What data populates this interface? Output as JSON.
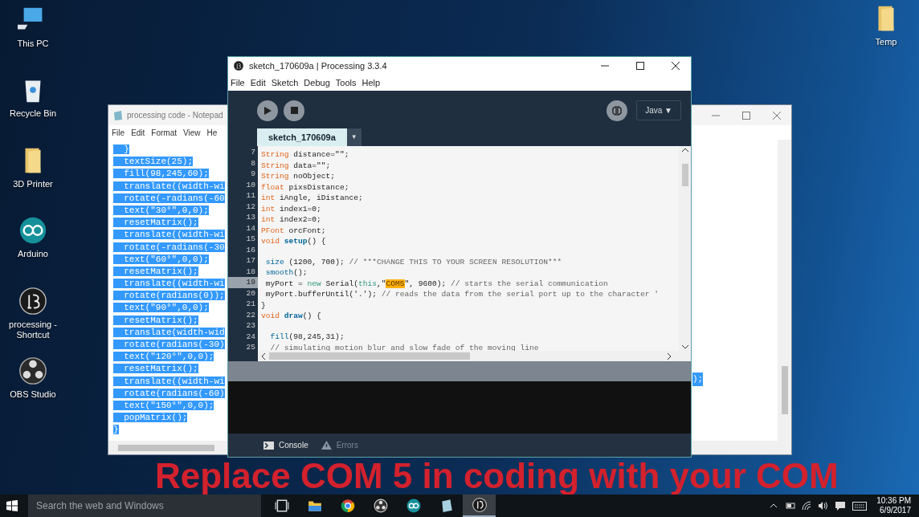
{
  "desktop_icons": [
    {
      "label": "This PC",
      "kind": "pc"
    },
    {
      "label": "Recycle Bin",
      "kind": "bin"
    },
    {
      "label": "3D Printer",
      "kind": "folder"
    },
    {
      "label": "Arduino",
      "kind": "arduino"
    },
    {
      "label": "processing - Shortcut",
      "kind": "processing"
    },
    {
      "label": "OBS Studio",
      "kind": "obs"
    },
    {
      "label": "Temp",
      "kind": "folder"
    }
  ],
  "notepad": {
    "title": "processing code - Notepad",
    "menu": [
      "File",
      "Edit",
      "Format",
      "View",
      "He"
    ],
    "lines": [
      {
        "text": "  }",
        "selected": true
      },
      {
        "text": "  textSize(25);",
        "selected": true
      },
      {
        "text": "  fill(98,245,60);",
        "selected": true
      },
      {
        "text": "  translate((width-wi",
        "selected": true
      },
      {
        "text": "  rotate(-radians(-60",
        "selected": true
      },
      {
        "text": "  text(\"30°\",0,0);",
        "selected": true
      },
      {
        "text": "  resetMatrix();",
        "selected": true
      },
      {
        "text": "  translate((width-wi",
        "selected": true
      },
      {
        "text": "  rotate(-radians(-30",
        "selected": true
      },
      {
        "text": "  text(\"60°\",0,0);",
        "selected": true
      },
      {
        "text": "  resetMatrix();",
        "selected": true
      },
      {
        "text": "  translate((width-wi",
        "selected": true
      },
      {
        "text": "  rotate(radians(0));",
        "selected": true
      },
      {
        "text": "  text(\"90°\",0,0);",
        "selected": true
      },
      {
        "text": "  resetMatrix();",
        "selected": true
      },
      {
        "text": "  translate(width-wid",
        "selected": true
      },
      {
        "text": "  rotate(radians(-30)",
        "selected": true
      },
      {
        "text": "  text(\"120°\",0,0);",
        "selected": true
      },
      {
        "text": "  resetMatrix();",
        "selected": true
      },
      {
        "text": "  translate((width-wi",
        "selected": true
      },
      {
        "text": "  rotate(radians(-60)",
        "selected": true
      },
      {
        "text": "  text(\"150°\",0,0);",
        "selected": true
      },
      {
        "text": "  popMatrix();",
        "selected": true
      },
      {
        "text": "}",
        "selected": true
      }
    ],
    "right_fragment": {
      "text": ");",
      "selected": true
    }
  },
  "processing": {
    "title": "sketch_170609a | Processing 3.3.4",
    "menu": [
      "File",
      "Edit",
      "Sketch",
      "Debug",
      "Tools",
      "Help"
    ],
    "mode": "Java ▼",
    "tabs": [
      {
        "label": "sketch_170609a",
        "selected": true
      }
    ],
    "tab_menu": "▼",
    "code": [
      {
        "number": "7",
        "current": false,
        "tokens": [
          {
            "kind": "type",
            "text": "String"
          },
          {
            "kind": "plain",
            "text": " distance=\"\";"
          }
        ]
      },
      {
        "number": "8",
        "current": false,
        "tokens": [
          {
            "kind": "type",
            "text": "String"
          },
          {
            "kind": "plain",
            "text": " data=\"\";"
          }
        ]
      },
      {
        "number": "9",
        "current": false,
        "tokens": [
          {
            "kind": "type",
            "text": "String"
          },
          {
            "kind": "plain",
            "text": " noObject;"
          }
        ]
      },
      {
        "number": "10",
        "current": false,
        "tokens": [
          {
            "kind": "type",
            "text": "float"
          },
          {
            "kind": "plain",
            "text": " pixsDistance;"
          }
        ]
      },
      {
        "number": "11",
        "current": false,
        "tokens": [
          {
            "kind": "type",
            "text": "int"
          },
          {
            "kind": "plain",
            "text": " iAngle, iDistance;"
          }
        ]
      },
      {
        "number": "12",
        "current": false,
        "tokens": [
          {
            "kind": "type",
            "text": "int"
          },
          {
            "kind": "plain",
            "text": " index1=0;"
          }
        ]
      },
      {
        "number": "13",
        "current": false,
        "tokens": [
          {
            "kind": "type",
            "text": "int"
          },
          {
            "kind": "plain",
            "text": " index2=0;"
          }
        ]
      },
      {
        "number": "14",
        "current": false,
        "tokens": [
          {
            "kind": "type",
            "text": "PFont"
          },
          {
            "kind": "plain",
            "text": " orcFont;"
          }
        ]
      },
      {
        "number": "15",
        "current": false,
        "tokens": [
          {
            "kind": "type",
            "text": "void"
          },
          {
            "kind": "function",
            "text": " setup"
          },
          {
            "kind": "plain",
            "text": "() {"
          }
        ]
      },
      {
        "number": "16",
        "current": false
      },
      {
        "number": "17",
        "current": false,
        "tokens": [
          {
            "kind": "builtin",
            "text": " size"
          },
          {
            "kind": "plain",
            "text": " (1200, 700); "
          },
          {
            "kind": "comment",
            "text": "// ***CHANGE THIS TO YOUR SCREEN RESOLUTION***"
          }
        ]
      },
      {
        "number": "18",
        "current": false,
        "tokens": [
          {
            "kind": "builtin",
            "text": " smooth"
          },
          {
            "kind": "plain",
            "text": "();"
          }
        ]
      },
      {
        "number": "19",
        "current": true,
        "tokens": [
          {
            "kind": "plain",
            "text": " myPort = "
          },
          {
            "kind": "keyword",
            "text": "new"
          },
          {
            "kind": "plain",
            "text": " Serial("
          },
          {
            "kind": "keyword",
            "text": "this"
          },
          {
            "kind": "plain",
            "text": ",\""
          },
          {
            "kind": "selection",
            "text": "COM5"
          },
          {
            "kind": "plain",
            "text": "\", 9600); "
          },
          {
            "kind": "comment",
            "text": "// starts the serial communication"
          }
        ]
      },
      {
        "number": "20",
        "current": false,
        "tokens": [
          {
            "kind": "plain",
            "text": " myPort.bufferUntil('.'); "
          },
          {
            "kind": "comment",
            "text": "// reads the data from the serial port up to the character '"
          }
        ]
      },
      {
        "number": "21",
        "current": false,
        "tokens": [
          {
            "kind": "plain",
            "text": "}"
          }
        ]
      },
      {
        "number": "22",
        "current": false,
        "tokens": [
          {
            "kind": "type",
            "text": "void"
          },
          {
            "kind": "function",
            "text": " draw"
          },
          {
            "kind": "plain",
            "text": "() {"
          }
        ]
      },
      {
        "number": "23",
        "current": false
      },
      {
        "number": "24",
        "current": false,
        "tokens": [
          {
            "kind": "builtin",
            "text": "  fill"
          },
          {
            "kind": "plain",
            "text": "(98,245,31);"
          }
        ]
      },
      {
        "number": "25",
        "current": false,
        "tokens": [
          {
            "kind": "comment",
            "text": "  // simulating motion blur and slow fade of the moving line"
          }
        ]
      }
    ],
    "console_tabs": [
      {
        "label": "Console",
        "kind": "console",
        "selected": true
      },
      {
        "label": "Errors",
        "kind": "errors",
        "selected": false
      }
    ]
  },
  "caption": "Replace COM 5 in coding with your COM",
  "taskbar": {
    "search_placeholder": "Search the web and Windows",
    "apps": [
      {
        "kind": "taskview",
        "selected": false
      },
      {
        "kind": "explorer",
        "selected": false
      },
      {
        "kind": "chrome",
        "selected": false
      },
      {
        "kind": "obs",
        "selected": false
      },
      {
        "kind": "arduino",
        "selected": false
      },
      {
        "kind": "notepad",
        "selected": false
      },
      {
        "kind": "processing",
        "selected": true
      }
    ],
    "time": "10:36 PM",
    "date": "6/9/2017"
  }
}
